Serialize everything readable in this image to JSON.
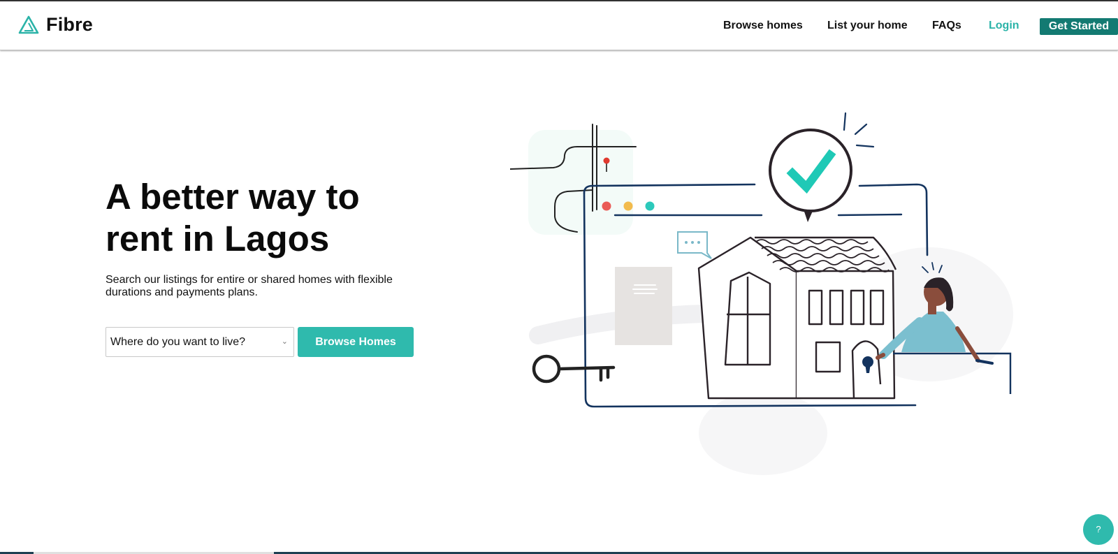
{
  "header": {
    "brand": "Fibre",
    "nav": {
      "browse": "Browse homes",
      "list": "List your home",
      "faqs": "FAQs",
      "login": "Login"
    },
    "cta": "Get Started"
  },
  "hero": {
    "title": "A better way to rent in Lagos",
    "subtitle": "Search our listings for entire or shared homes with flexible durations and payments plans.",
    "location_select": {
      "value": "Where do you want to live?"
    },
    "browse_button": "Browse Homes"
  },
  "help": {
    "label": "?"
  },
  "colors": {
    "brand": "#2fbaad",
    "cta_dark": "#137a72",
    "navy": "#13335e",
    "illustration_bg": "#f4fbf9"
  },
  "icons": {
    "logo": "triangle-logo-icon",
    "select": "chevron-down-icon",
    "check": "checkmark-icon",
    "key": "key-icon",
    "chat": "chat-bubble-icon",
    "pin": "map-pin-icon"
  }
}
